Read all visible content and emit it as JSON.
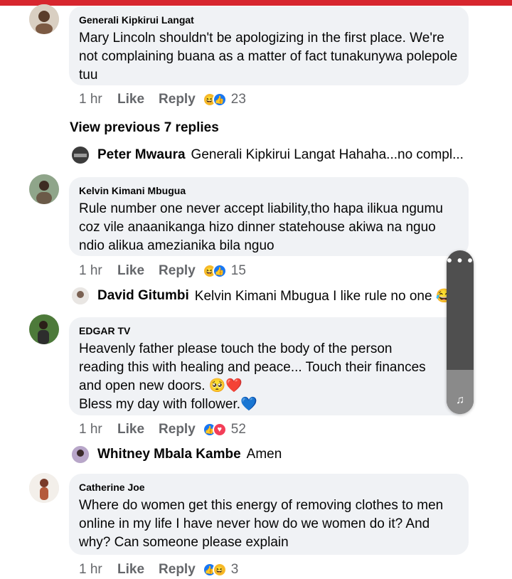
{
  "comments": [
    {
      "author": "Generali Kipkirui Langat",
      "text": "Mary Lincoln shouldn't be apologizing in the first place. We're not complaining buana as a matter of fact tunakunywa polepole tuu",
      "time": "1 hr",
      "like": "Like",
      "reply": "Reply",
      "reactions": [
        "haha",
        "like"
      ],
      "count": "23"
    },
    {
      "author": "Kelvin Kimani Mbugua",
      "text": "Rule number one never accept liability,tho hapa ilikua ngumu coz vile anaanikanga hizo dinner statehouse akiwa na nguo ndio alikua amezianika bila nguo",
      "time": "1 hr",
      "like": "Like",
      "reply": "Reply",
      "reactions": [
        "haha",
        "like"
      ],
      "count": "15"
    },
    {
      "author": "EDGAR TV",
      "text_line1": "Heavenly father please touch the body of the person reading this with healing and peace... Touch their finances and open new doors. 🥺❤️",
      "text_line2": "Bless my day with follower.💙",
      "time": "1 hr",
      "like": "Like",
      "reply": "Reply",
      "reactions": [
        "like",
        "love"
      ],
      "count": "52"
    },
    {
      "author": "Catherine Joe",
      "text": "Where do women get this energy of removing clothes to men online in my life I have never how do we women do it? And why? Can someone please explain",
      "time": "1 hr",
      "like": "Like",
      "reply": "Reply",
      "reactions": [
        "like",
        "haha"
      ],
      "count": "3"
    }
  ],
  "view_previous": "View previous 7 replies",
  "replies": [
    {
      "author": "Peter Mwaura",
      "text": "Generali Kipkirui Langat Hahaha...no compl..."
    },
    {
      "author": "David Gitumbi",
      "text": "Kelvin Kimani Mbugua I like rule no one 😂"
    },
    {
      "author": "Whitney Mbala Kambe",
      "text": "Amen"
    }
  ],
  "floating_panel": {
    "menu_icon": "more-dots-icon",
    "audio_icon": "music-note-icon"
  },
  "colors": {
    "accent_bar": "#d7262e",
    "bubble": "#f0f2f5",
    "meta": "#65676b",
    "like_blue": "#1877f2",
    "love_red": "#f33e58",
    "haha_yellow": "#f7b928"
  }
}
